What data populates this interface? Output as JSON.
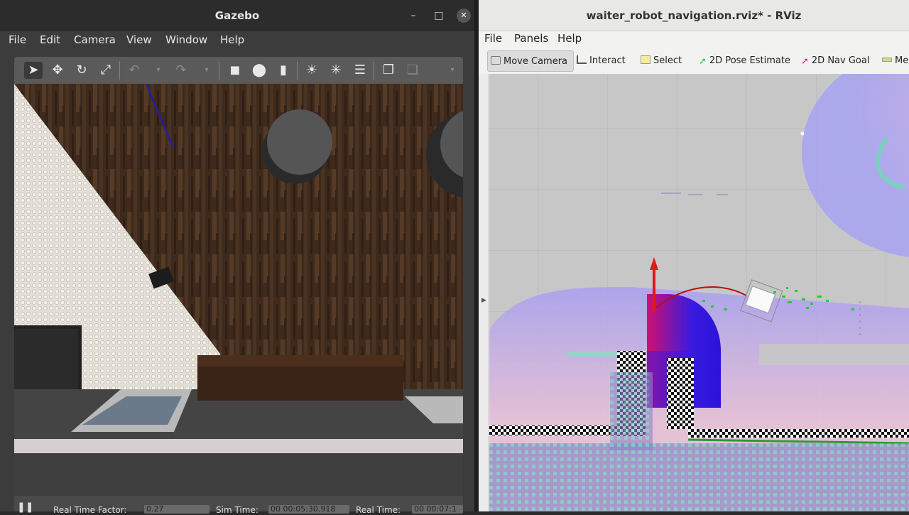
{
  "gazebo": {
    "title": "Gazebo",
    "menu": [
      "File",
      "Edit",
      "Camera",
      "View",
      "Window",
      "Help"
    ],
    "toolbar_icons": [
      "select-arrow-icon",
      "translate-icon",
      "rotate-icon",
      "scale-icon",
      "undo-icon",
      "undo-dropdown-icon",
      "redo-icon",
      "redo-dropdown-icon",
      "box-icon",
      "sphere-icon",
      "cylinder-icon",
      "point-light-icon",
      "spot-light-icon",
      "directional-light-icon",
      "copy-icon",
      "paste-icon"
    ],
    "status": {
      "real_time_factor_label": "Real Time Factor:",
      "real_time_factor": "0.27",
      "sim_time_label": "Sim Time:",
      "sim_time": "00 00:05:30.918",
      "real_time_label": "Real Time:",
      "real_time": "00 00:07:1"
    }
  },
  "rviz": {
    "title": "waiter_robot_navigation.rviz* - RViz",
    "menu": [
      "File",
      "Panels",
      "Help"
    ],
    "tools": [
      {
        "label": "Move Camera",
        "icon": "move-camera-icon",
        "color": "#7a7a7a"
      },
      {
        "label": "Interact",
        "icon": "hand-icon",
        "color": "#555555"
      },
      {
        "label": "Select",
        "icon": "select-box-icon",
        "color": "#f3ec9a"
      },
      {
        "label": "2D Pose Estimate",
        "icon": "pose-estimate-arrow-icon",
        "color": "#22cc33"
      },
      {
        "label": "2D Nav Goal",
        "icon": "nav-goal-arrow-icon",
        "color": "#cc22aa"
      },
      {
        "label": "Me",
        "icon": "measure-icon",
        "color": "#99aa66"
      }
    ]
  }
}
